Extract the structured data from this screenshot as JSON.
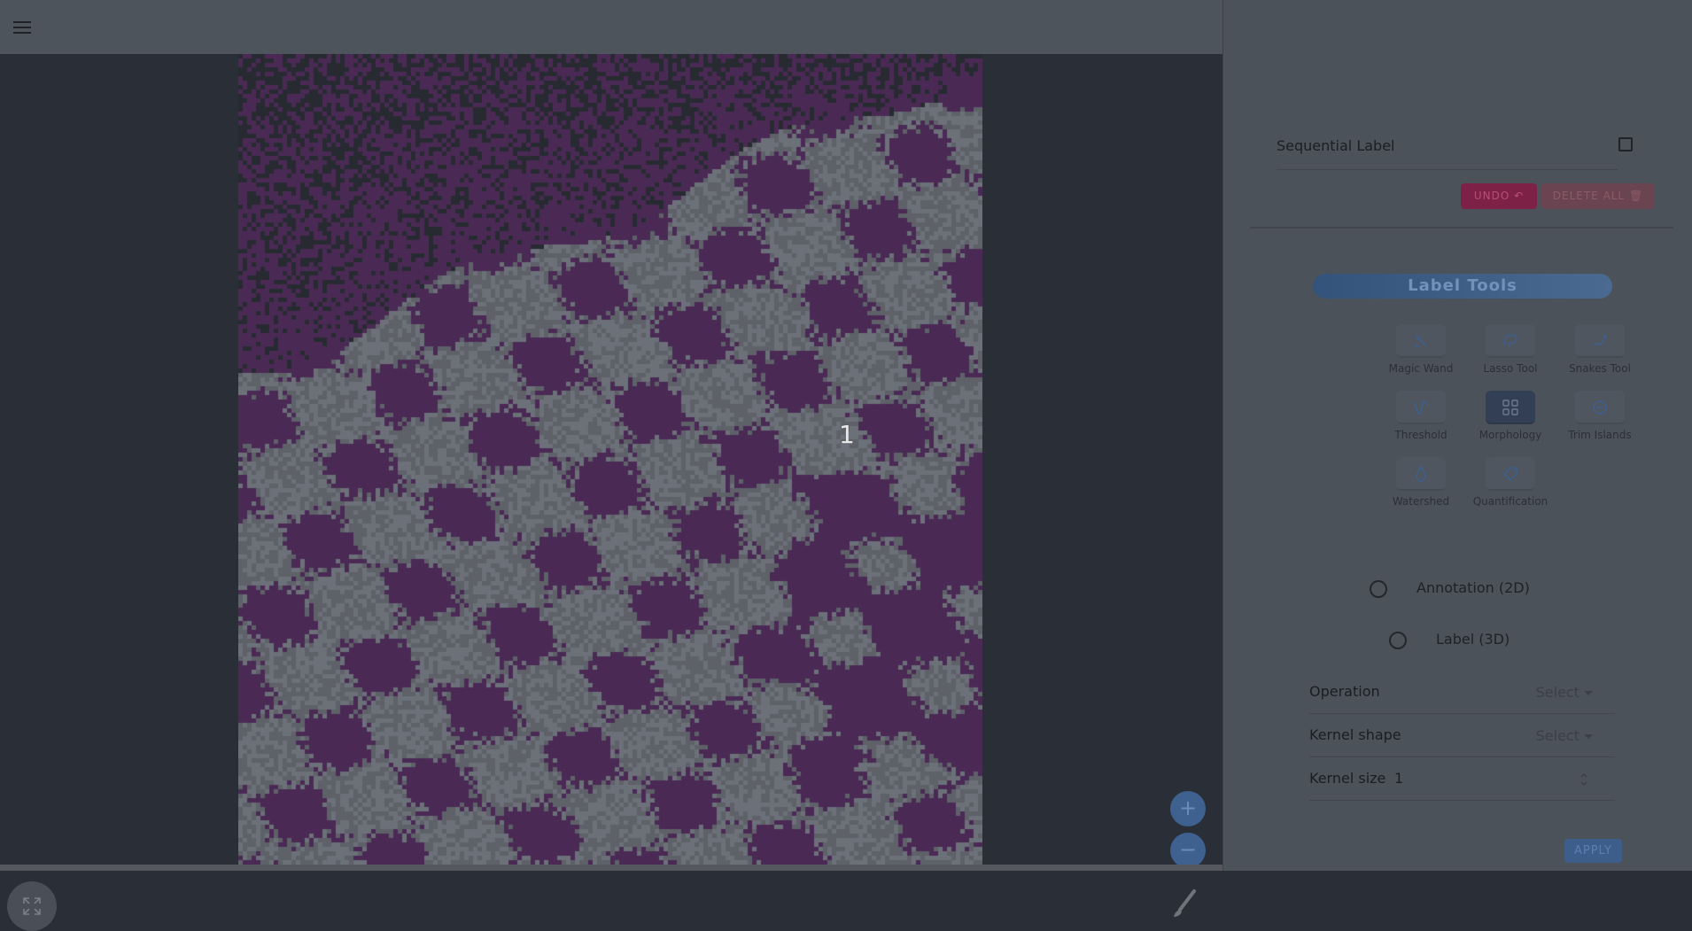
{
  "canvas": {
    "label": "1",
    "colors": {
      "purple": "#4a2a55",
      "dark": "#272a31",
      "gray": "#5e6168",
      "light_gray": "#6c7078"
    }
  },
  "viewer": {
    "zoom_in_label": "+",
    "zoom_out_label": "−"
  },
  "panel": {
    "sequential_label": "Sequential Label",
    "sequential_checked": false,
    "undo_label": "UNDO ↶",
    "delete_all_label": "DELETE ALL 🗑",
    "label_tools_title": "Label Tools",
    "tools": [
      {
        "label": "Magic Wand",
        "icon": "magic-wand-icon",
        "active": false
      },
      {
        "label": "Lasso Tool",
        "icon": "lasso-icon",
        "active": false
      },
      {
        "label": "Snakes Tool",
        "icon": "snakes-icon",
        "active": false
      },
      {
        "label": "Threshold",
        "icon": "threshold-icon",
        "active": false
      },
      {
        "label": "Morphology",
        "icon": "grid-icon",
        "active": true
      },
      {
        "label": "Trim Islands",
        "icon": "minus-circle-icon",
        "active": false
      },
      {
        "label": "Watershed",
        "icon": "droplet-icon",
        "active": false
      },
      {
        "label": "Quantification",
        "icon": "tag-icon",
        "active": false
      }
    ],
    "mode_options": [
      {
        "label": "Annotation (2D)",
        "selected": false
      },
      {
        "label": "Label (3D)",
        "selected": false
      }
    ],
    "params": {
      "operation": {
        "label": "Operation",
        "value": "Select"
      },
      "kernel_shape": {
        "label": "Kernel shape",
        "value": "Select"
      },
      "kernel_size": {
        "label": "Kernel size",
        "value": "1"
      }
    },
    "apply_label": "APPLY"
  }
}
